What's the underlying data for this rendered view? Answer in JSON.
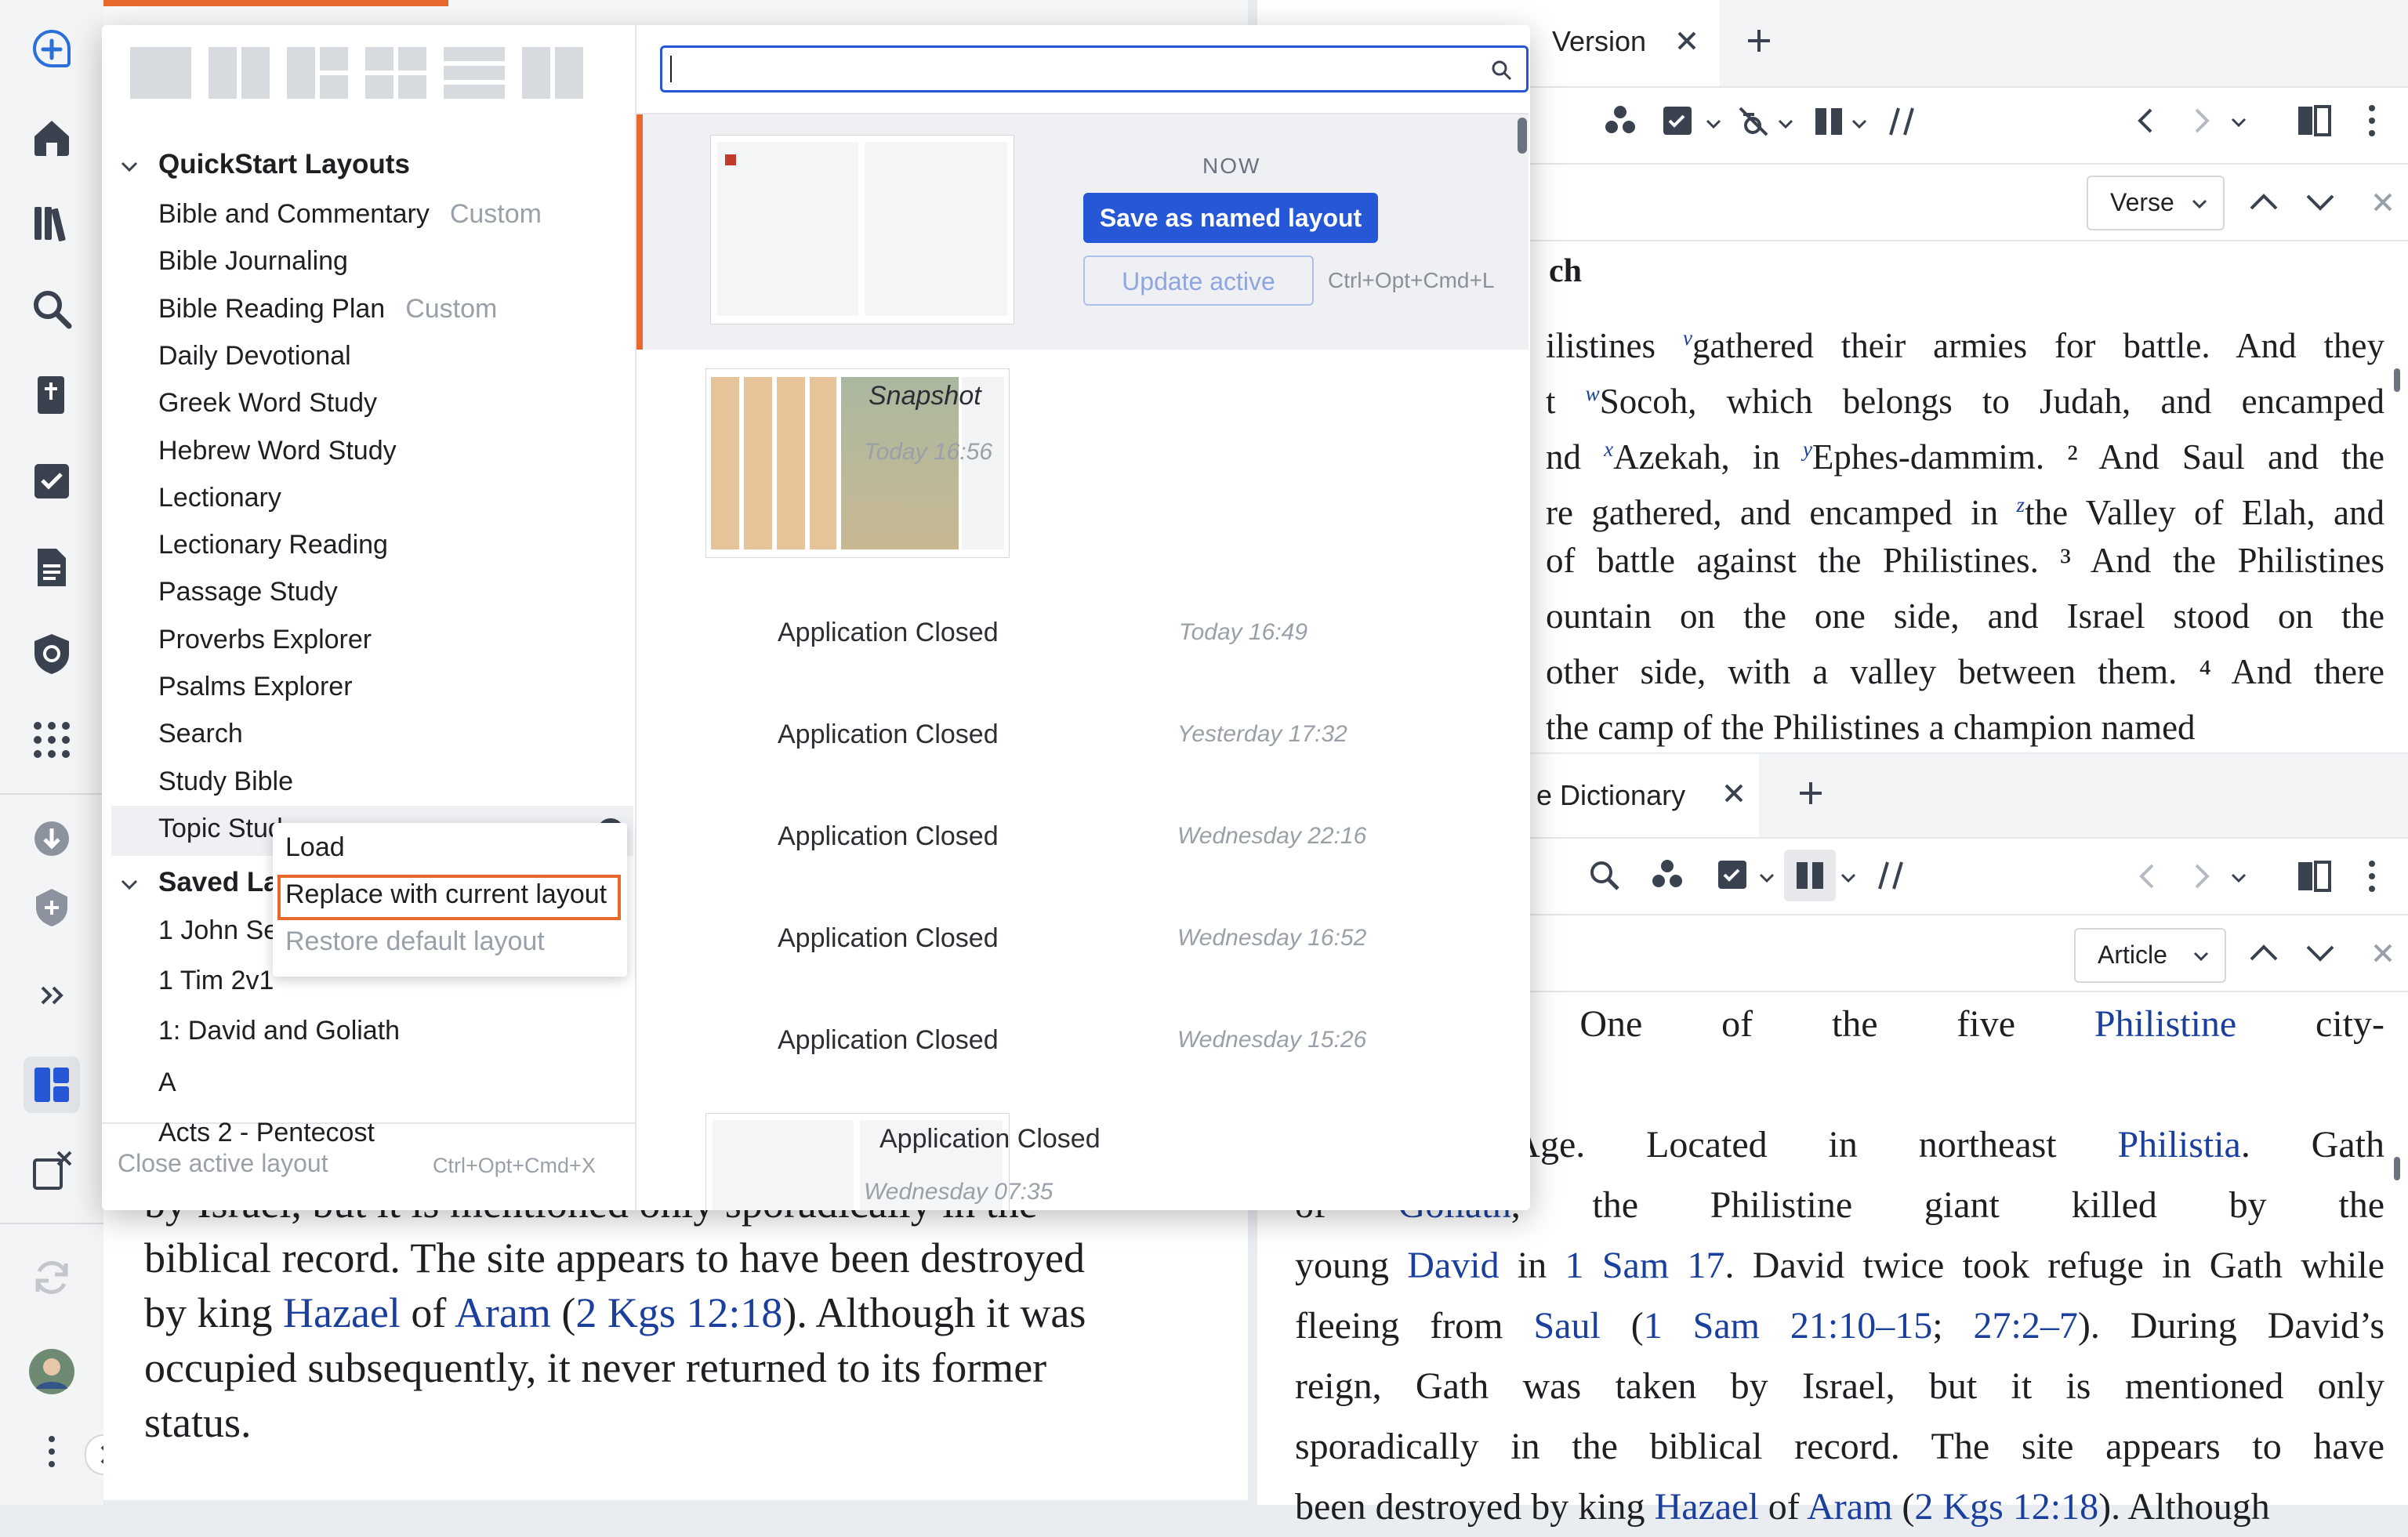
{
  "tabs": {
    "top_right": "Version",
    "bottom_right": "e Dictionary"
  },
  "bible_panel": {
    "verse_button": "Verse",
    "heading": "ch",
    "lines": [
      [
        "ilistines ",
        {
          "sup": "v"
        },
        "gathered their armies for battle. And they"
      ],
      [
        "t ",
        {
          "sup": "w"
        },
        "Socoh, which belongs to Judah, and encamped"
      ],
      [
        "nd ",
        {
          "sup": "x"
        },
        "Azekah, in ",
        {
          "sup": "y"
        },
        "Ephes-dammim. ² And Saul and the"
      ],
      [
        "re gathered, and encamped in ",
        {
          "sup": "z"
        },
        "the Valley of Elah, and"
      ],
      [
        "of battle against the Philistines. ³ And the Philistines"
      ],
      [
        "ountain on the one side, and Israel stood on the"
      ],
      [
        " other side, with a valley between them. ⁴ And there"
      ],
      [
        " the camp of the Philistines a champion named"
      ]
    ]
  },
  "dictionary_panel": {
    "article_button": "Article",
    "lines": [
      [
        "“winepress”). One of the five ",
        {
          "link": "Philistine"
        },
        " city-"
      ],
      [],
      [
        "ne Iron Age. Located in northeast ",
        {
          "link": "Philistia"
        },
        ". Gath"
      ],
      [
        " of ",
        {
          "link": "Goliath"
        },
        ", the Philistine giant killed by the"
      ],
      [
        "young ",
        {
          "link": "David"
        },
        " in ",
        {
          "link": "1 Sam 17"
        },
        ". David twice took refuge in Gath while"
      ],
      [
        "fleeing from ",
        {
          "link": "Saul"
        },
        " (",
        {
          "link": "1 Sam 21:10–15"
        },
        "; ",
        {
          "link": "27:2–7"
        },
        "). During David’s"
      ],
      [
        "reign, Gath was taken by Israel, but it is mentioned only"
      ],
      [
        "sporadically in the biblical record. The site appears to have"
      ],
      [
        "been destroyed by king ",
        {
          "link": "Hazael"
        },
        " of ",
        {
          "link": "Aram"
        },
        " (",
        {
          "link": "2 Kgs 12:18"
        },
        "). Although"
      ]
    ]
  },
  "left_panel": {
    "lines": [
      [
        "by Israel, but it is mentioned only sporadically in the"
      ],
      [
        "biblical record. The site appears to have been destroyed"
      ],
      [
        "by king ",
        {
          "link": "Hazael"
        },
        " of ",
        {
          "link": "Aram"
        },
        " (",
        {
          "link": "2 Kgs 12:18"
        },
        "). Although it was"
      ],
      [
        "occupied subsequently, it never returned to its former"
      ],
      [
        "status."
      ]
    ]
  },
  "popup": {
    "search_placeholder": "",
    "groups": {
      "quickstart": "QuickStart Layouts",
      "saved": "Saved Lay"
    },
    "quickstart_items": [
      {
        "label": "Bible and Commentary",
        "tag": "Custom"
      },
      {
        "label": "Bible Journaling",
        "tag": ""
      },
      {
        "label": "Bible Reading Plan",
        "tag": "Custom"
      },
      {
        "label": "Daily Devotional",
        "tag": ""
      },
      {
        "label": "Greek Word Study",
        "tag": ""
      },
      {
        "label": "Hebrew Word Study",
        "tag": ""
      },
      {
        "label": "Lectionary",
        "tag": ""
      },
      {
        "label": "Lectionary Reading",
        "tag": ""
      },
      {
        "label": "Passage Study",
        "tag": ""
      },
      {
        "label": "Proverbs Explorer",
        "tag": ""
      },
      {
        "label": "Psalms Explorer",
        "tag": ""
      },
      {
        "label": "Search",
        "tag": ""
      },
      {
        "label": "Study Bible",
        "tag": ""
      },
      {
        "label": "Topic Study",
        "tag": ""
      }
    ],
    "saved_items": [
      "1 John Se",
      "1 Tim 2v1",
      "1: David and Goliath",
      "A",
      "Acts 2 - Pentecost"
    ],
    "context_menu": {
      "load": "Load",
      "replace": "Replace with current layout",
      "restore": "Restore default layout"
    },
    "close_active": "Close active layout",
    "close_shortcut": "Ctrl+Opt+Cmd+X",
    "now_label": "NOW",
    "save_named": "Save as named layout",
    "update_active": "Update active",
    "update_shortcut": "Ctrl+Opt+Cmd+L",
    "snapshots": [
      {
        "label": "Snapshot",
        "time": "Today 16:56"
      },
      {
        "label": "Application Closed",
        "time": "Today 16:49"
      },
      {
        "label": "Application Closed",
        "time": "Yesterday 17:32"
      },
      {
        "label": "Application Closed",
        "time": "Wednesday 22:16"
      },
      {
        "label": "Application Closed",
        "time": "Wednesday 16:52"
      },
      {
        "label": "Application Closed",
        "time": "Wednesday 15:26"
      },
      {
        "label": "Application Closed",
        "time": "Wednesday 07:35"
      }
    ]
  },
  "colors": {
    "accent_orange": "#e8692c",
    "primary_blue": "#2657d6",
    "link_blue": "#1a3f9c"
  }
}
